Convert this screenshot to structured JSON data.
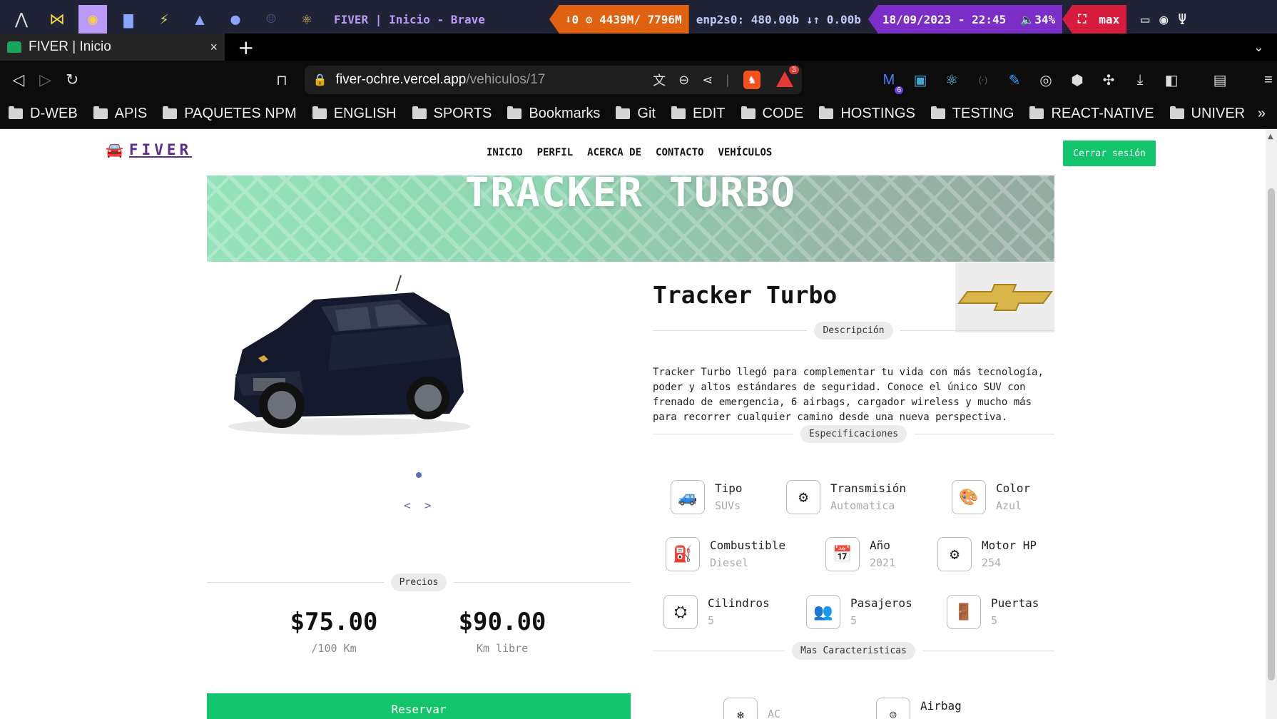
{
  "sysbar": {
    "window_title": "FIVER | Inicio - Brave",
    "resources": "⬇0 ⚙ 4439M/ 7796M",
    "network": "enp2s0: 480.00b ↓↑  0.00b",
    "datetime": "18/09/2023 - 22:45",
    "volume": "🔈34%",
    "layout": "max"
  },
  "tab": {
    "title": "FIVER | Inicio",
    "close": "×",
    "new": "+",
    "menu": "⌄"
  },
  "toolbar": {
    "url_host": "fiver-ochre.vercel.app",
    "url_path": "/vehiculos/17",
    "rewards_count": "3",
    "extension_badge": "6"
  },
  "bookmarks": [
    "D-WEB",
    "APIS",
    "PAQUETES NPM",
    "ENGLISH",
    "SPORTS",
    "Bookmarks",
    "Git",
    "EDIT",
    "CODE",
    "HOSTINGS",
    "TESTING",
    "REACT-NATIVE",
    "UNIVER"
  ],
  "bookmarks_more": "»",
  "page": {
    "logo": "FIVER",
    "nav": [
      "INICIO",
      "PERFIL",
      "ACERCA DE",
      "CONTACTO",
      "VEHÍCULOS"
    ],
    "logout": "Cerrar sesión",
    "banner_title": "TRACKER TURBO",
    "carousel_prev": "<",
    "carousel_next": ">",
    "prices_label": "Precios",
    "prices": [
      {
        "value": "$75.00",
        "unit": "/100 Km"
      },
      {
        "value": "$90.00",
        "unit": "Km libre"
      }
    ],
    "reserve": "Reservar",
    "vehicle_name": "Tracker Turbo",
    "description_label": "Descripción",
    "description": "Tracker Turbo llegó para complementar tu vida con más tecnología, poder y altos estándares de seguridad. Conoce el único SUV con frenado de emergencia, 6 airbags, cargador wireless y mucho más para recorrer cualquier camino desde una nueva perspectiva.",
    "specs_label": "Especificaciones",
    "specs": [
      {
        "name": "Tipo",
        "value": "SUVs",
        "icon": "suv-icon"
      },
      {
        "name": "Transmisión",
        "value": "Automatica",
        "icon": "gearshift-icon"
      },
      {
        "name": "Color",
        "value": "Azul",
        "icon": "palette-icon"
      },
      {
        "name": "Combustible",
        "value": "Diesel",
        "icon": "fuel-pump-icon"
      },
      {
        "name": "Año",
        "value": "2021",
        "icon": "calendar-icon"
      },
      {
        "name": "Motor HP",
        "value": "254",
        "icon": "engine-icon"
      },
      {
        "name": "Cilindros",
        "value": "5",
        "icon": "cylinders-icon"
      },
      {
        "name": "Pasajeros",
        "value": "5",
        "icon": "passengers-icon"
      },
      {
        "name": "Puertas",
        "value": "5",
        "icon": "door-icon"
      }
    ],
    "more_label": "Mas Caracteristicas",
    "features": [
      {
        "name": "AC",
        "icon": "ac-icon"
      },
      {
        "name": "Airbag",
        "icon": "airbag-icon"
      }
    ]
  },
  "colors": {
    "accent": "#12c56c",
    "logo": "#5b2c8f",
    "carousel": "#5b6bbf"
  }
}
